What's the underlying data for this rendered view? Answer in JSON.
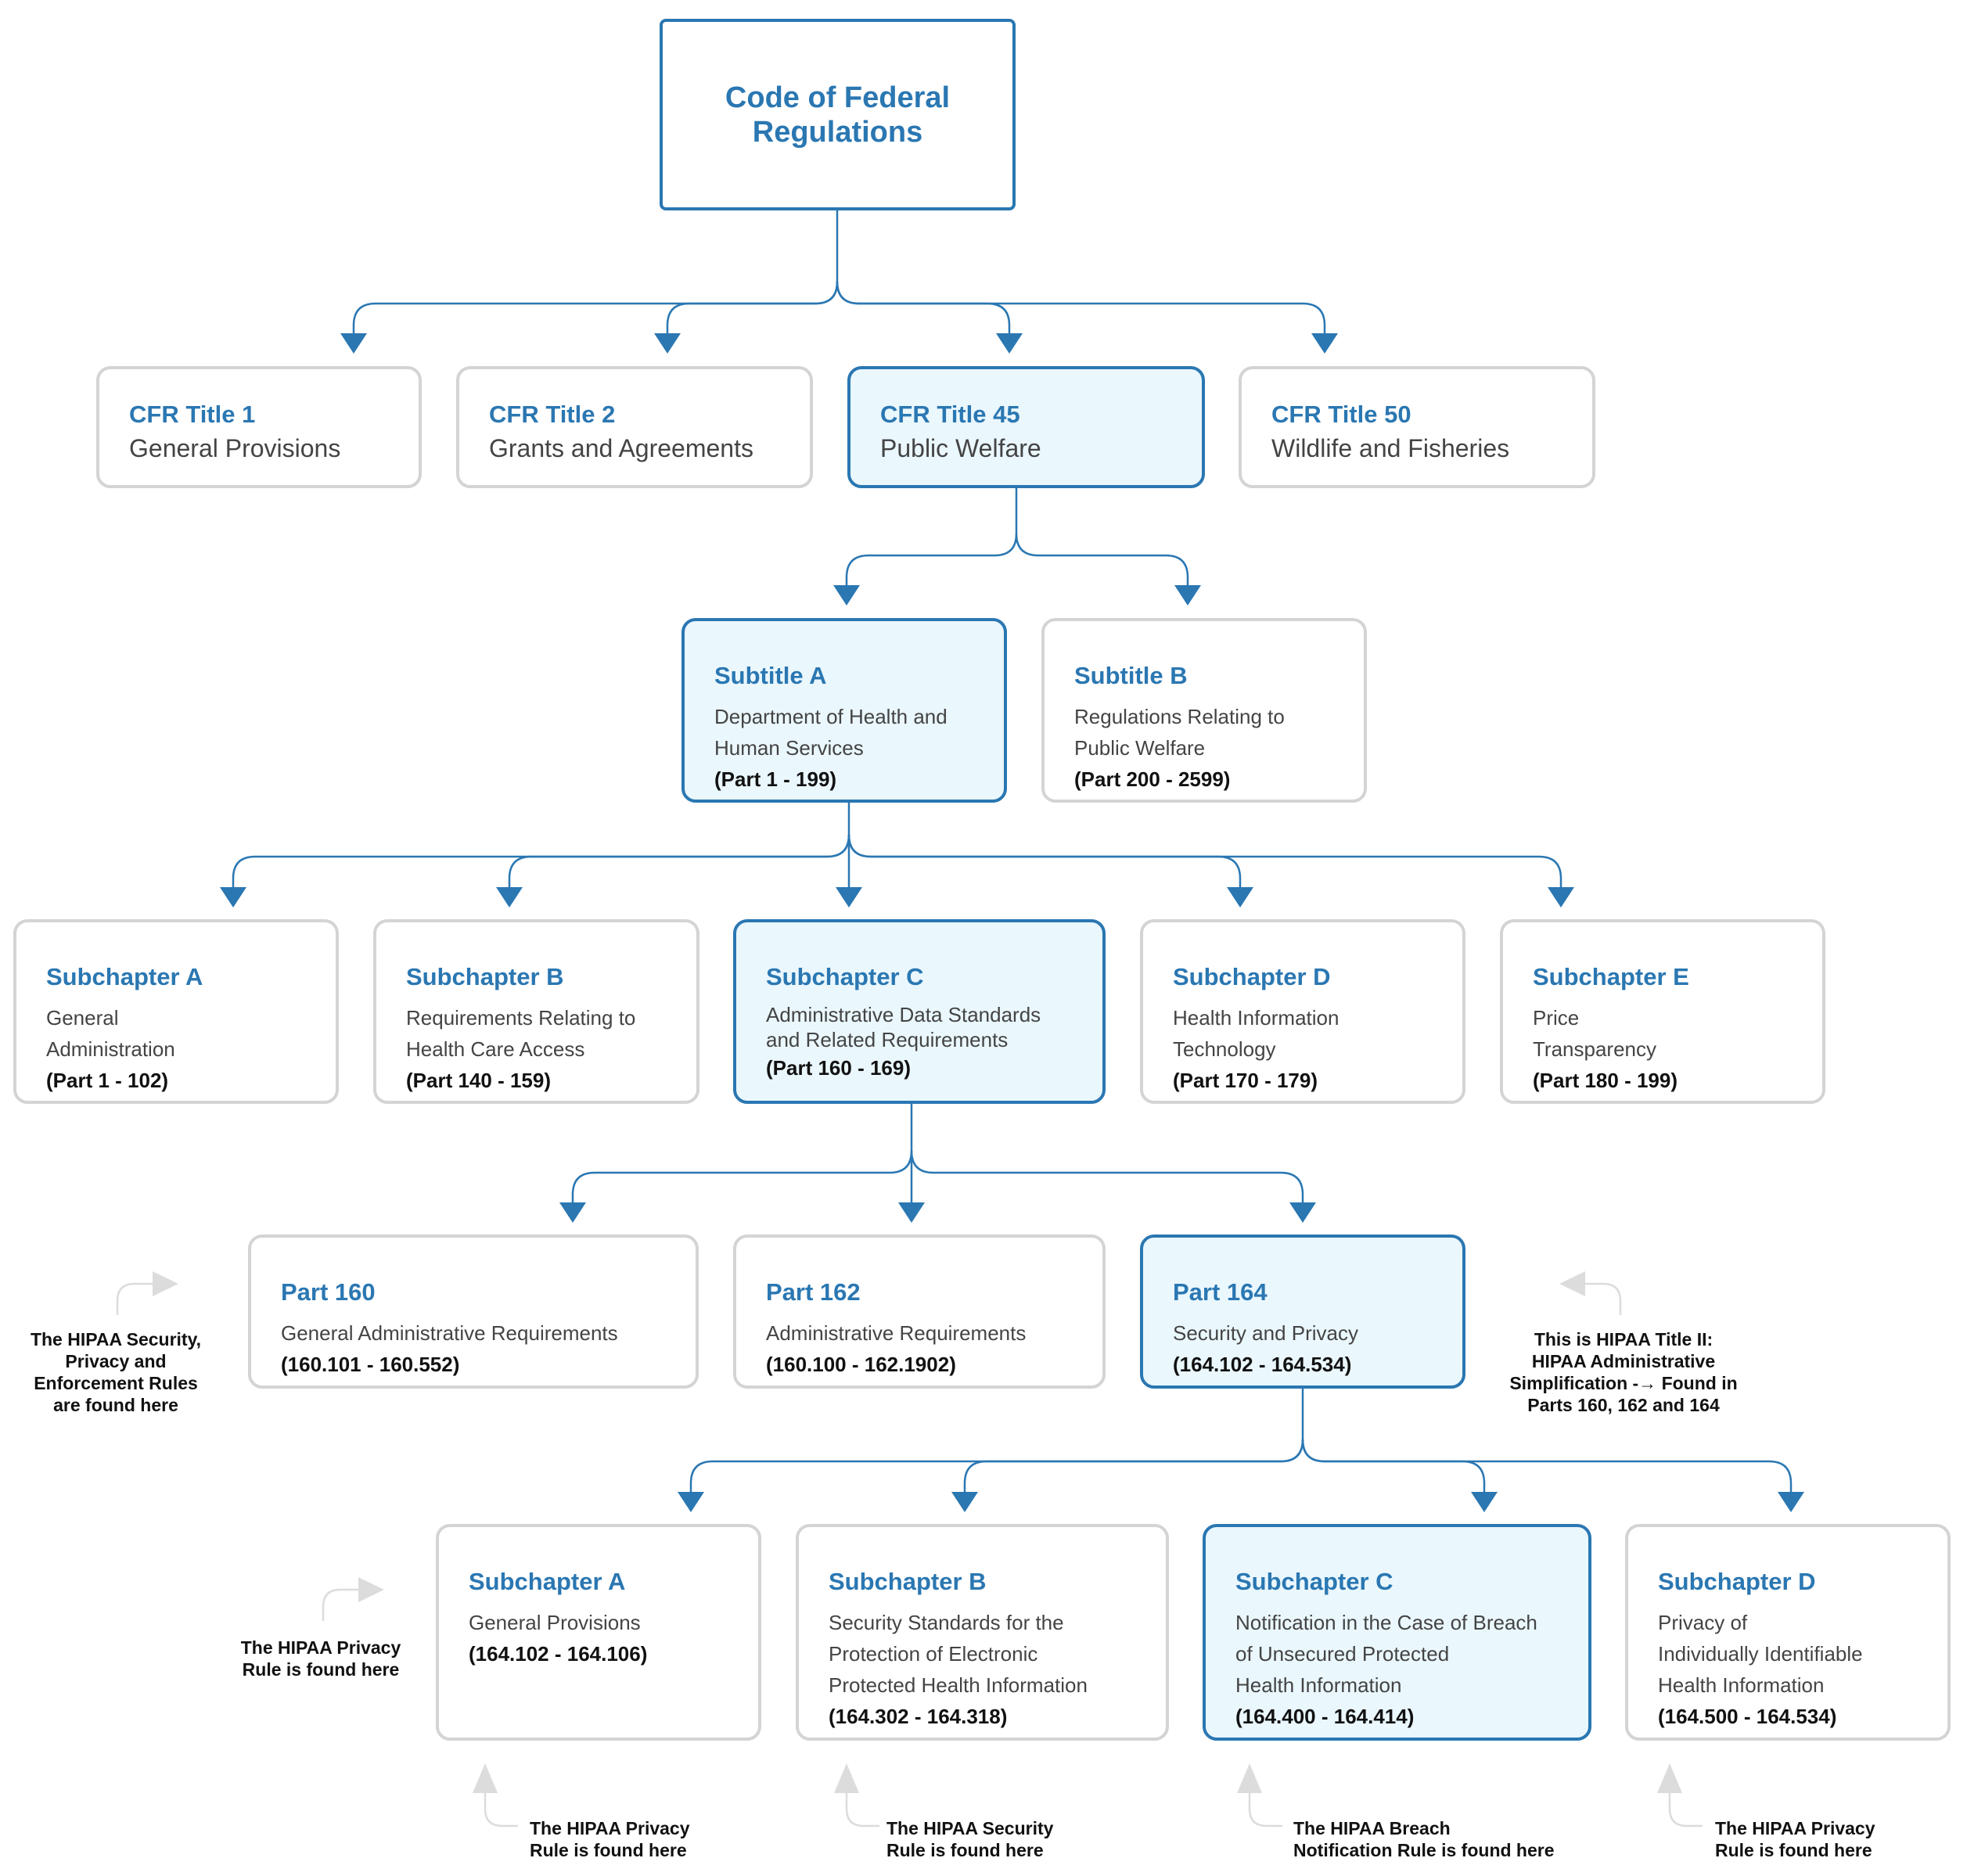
{
  "colors": {
    "accent": "#2a77b2",
    "highlight_fill": "#eaf7fd",
    "neutral_border": "#d4d4d4",
    "annotation_arrow": "#d9d9d9",
    "body_text": "#444444",
    "range_text": "#111111"
  },
  "root": {
    "title": "Code of Federal Regulations"
  },
  "titles": [
    {
      "title": "CFR Title 1",
      "desc": "General Provisions",
      "highlighted": false
    },
    {
      "title": "CFR Title 2",
      "desc": "Grants and Agreements",
      "highlighted": false
    },
    {
      "title": "CFR Title 45",
      "desc": "Public Welfare",
      "highlighted": true
    },
    {
      "title": "CFR Title 50",
      "desc": "Wildlife and Fisheries",
      "highlighted": false
    }
  ],
  "subtitles": [
    {
      "title": "Subtitle A",
      "desc_lines": [
        "Department of Health and",
        "Human Services"
      ],
      "range": "(Part 1 - 199)",
      "highlighted": true
    },
    {
      "title": "Subtitle B",
      "desc_lines": [
        "Regulations Relating to",
        "Public Welfare"
      ],
      "range": "(Part 200 - 2599)",
      "highlighted": false
    }
  ],
  "subchapters": [
    {
      "title": "Subchapter A",
      "desc_lines": [
        "General",
        "Administration"
      ],
      "range": "(Part 1 - 102)",
      "highlighted": false
    },
    {
      "title": "Subchapter B",
      "desc_lines": [
        "Requirements Relating to",
        "Health Care Access"
      ],
      "range": "(Part 140 - 159)",
      "highlighted": false
    },
    {
      "title": "Subchapter C",
      "desc_lines": [
        "Administrative Data Standards",
        "and Related Requirements"
      ],
      "range": "(Part 160 - 169)",
      "highlighted": true
    },
    {
      "title": "Subchapter D",
      "desc_lines": [
        "Health Information",
        "Technology"
      ],
      "range": "(Part 170 - 179)",
      "highlighted": false
    },
    {
      "title": "Subchapter E",
      "desc_lines": [
        "Price",
        "Transparency"
      ],
      "range": "(Part 180 - 199)",
      "highlighted": false
    }
  ],
  "parts": [
    {
      "title": "Part 160",
      "desc": "General Administrative Requirements",
      "range": "(160.101 - 160.552)",
      "highlighted": false
    },
    {
      "title": "Part 162",
      "desc": "Administrative Requirements",
      "range": "(160.100 - 162.1902)",
      "highlighted": false
    },
    {
      "title": "Part 164",
      "desc": "Security and Privacy",
      "range": "(164.102 - 164.534)",
      "highlighted": true
    }
  ],
  "part164_subchapters": [
    {
      "title": "Subchapter A",
      "desc_lines": [
        "General Provisions"
      ],
      "range": "(164.102 - 164.106)",
      "highlighted": false
    },
    {
      "title": "Subchapter B",
      "desc_lines": [
        "Security Standards for the",
        "Protection of Electronic",
        "Protected Health Information"
      ],
      "range": "(164.302 - 164.318)",
      "highlighted": false
    },
    {
      "title": "Subchapter C",
      "desc_lines": [
        "Notification in the Case of Breach",
        "of Unsecured Protected",
        "Health Information"
      ],
      "range": "(164.400 - 164.414)",
      "highlighted": true
    },
    {
      "title": "Subchapter D",
      "desc_lines": [
        "Privacy of",
        "Individually Identifiable",
        "Health Information"
      ],
      "range": "(164.500 - 164.534)",
      "highlighted": false
    }
  ],
  "annotations": {
    "parts_left": [
      "The HIPAA Security,",
      "Privacy and",
      "Enforcement Rules",
      "are found here"
    ],
    "parts_right": [
      "This is HIPAA Title II:",
      "HIPAA Administrative",
      "Simplification -→ Found in",
      "Parts 160, 162 and 164"
    ],
    "subA_left": [
      "The HIPAA Privacy",
      "Rule is found here"
    ],
    "below_A": [
      "The HIPAA Privacy",
      "Rule is found here"
    ],
    "below_B": [
      "The HIPAA Security",
      "Rule is found here"
    ],
    "below_C": [
      "The HIPAA Breach",
      "Notification Rule is found here"
    ],
    "below_D": [
      "The HIPAA Privacy",
      "Rule is found here"
    ]
  }
}
